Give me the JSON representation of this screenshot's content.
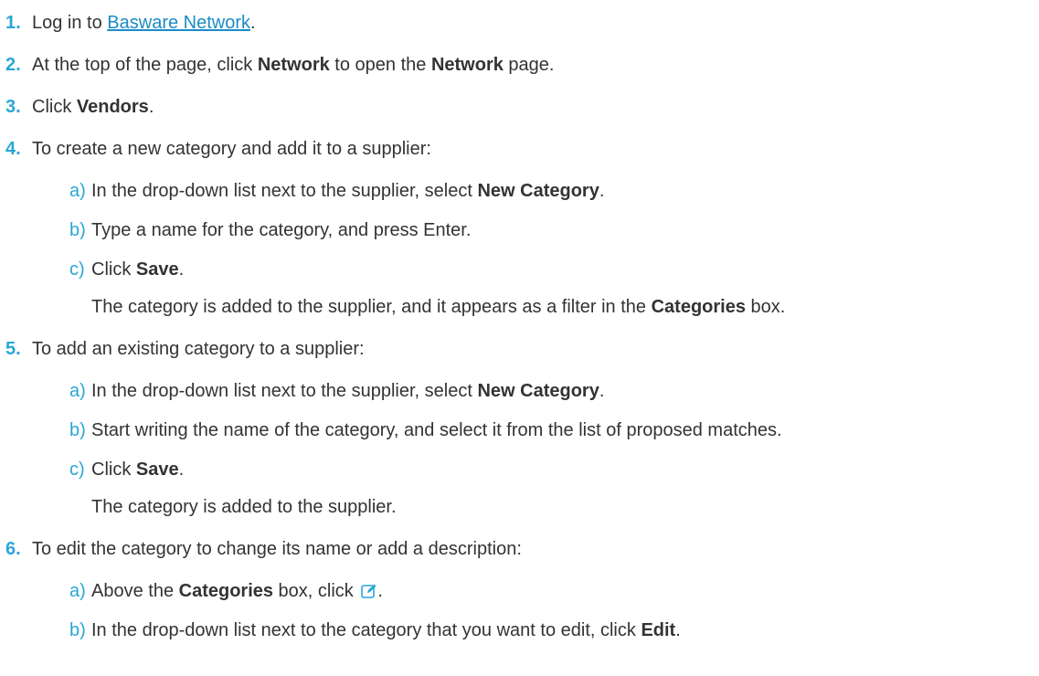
{
  "steps": [
    {
      "num": "1.",
      "pre": "Log in to ",
      "link": "Basware Network",
      "post": "."
    },
    {
      "num": "2.",
      "t1": "At the top of the page, click ",
      "b1": "Network",
      "t2": " to open the ",
      "b2": "Network",
      "t3": " page."
    },
    {
      "num": "3.",
      "t1": "Click ",
      "b1": "Vendors",
      "t2": "."
    },
    {
      "num": "4.",
      "text": "To create a new category and add it to a supplier:",
      "subs": [
        {
          "letter": "a)",
          "t1": "In the drop-down list next to the supplier, select ",
          "b1": "New Category",
          "t2": "."
        },
        {
          "letter": "b)",
          "t1": "Type a name for the category, and press Enter."
        },
        {
          "letter": "c)",
          "t1": "Click ",
          "b1": "Save",
          "t2": "."
        }
      ],
      "result": {
        "t1": "The category is added to the supplier, and it appears as a filter in the ",
        "b1": "Categories",
        "t2": " box."
      }
    },
    {
      "num": "5.",
      "text": "To add an existing category to a supplier:",
      "subs": [
        {
          "letter": "a)",
          "t1": "In the drop-down list next to the supplier, select ",
          "b1": "New Category",
          "t2": "."
        },
        {
          "letter": "b)",
          "t1": "Start writing the name of the category, and select it from the list of proposed matches."
        },
        {
          "letter": "c)",
          "t1": "Click ",
          "b1": "Save",
          "t2": "."
        }
      ],
      "result": {
        "t1": "The category is added to the supplier."
      }
    },
    {
      "num": "6.",
      "text": "To edit the category to change its name or add a description:",
      "subs": [
        {
          "letter": "a)",
          "t1": "Above the ",
          "b1": "Categories",
          "t2": " box, click ",
          "icon": "edit-icon",
          "t3": "."
        },
        {
          "letter": "b)",
          "t1": "In the drop-down list next to the category that you want to edit, click ",
          "b1": "Edit",
          "t2": "."
        }
      ]
    }
  ],
  "colors": {
    "number": "#2aa6d6",
    "link": "#1a8cc7",
    "text": "#333333"
  }
}
